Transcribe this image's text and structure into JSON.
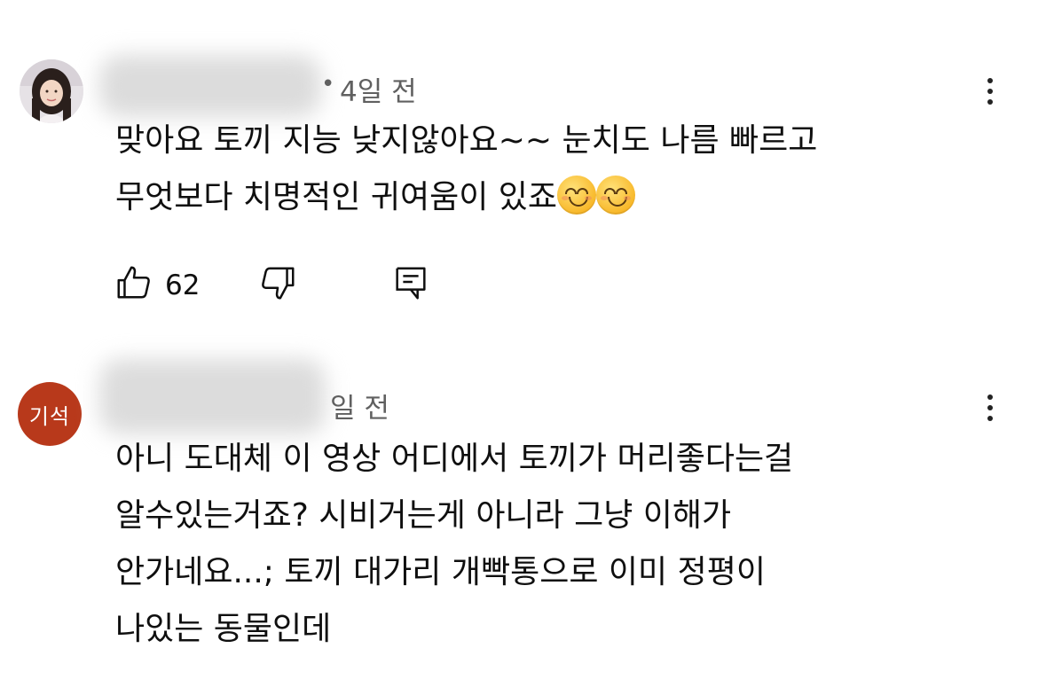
{
  "comments": [
    {
      "time": "4일 전",
      "separator": "•",
      "text_lines": [
        "맞아요 토끼 지능 낮지않아요~~ 눈치도 나름  빠르고",
        "무엇보다 치명적인 귀여움이 있죠"
      ],
      "emoji": [
        "smiling-face-emoji",
        "smiling-face-emoji"
      ],
      "likes": "62",
      "actions": [
        "like-icon",
        "dislike-icon",
        "reply-icon"
      ]
    },
    {
      "avatar_text": "기석",
      "avatar_color": "#b8391b",
      "time": "일 전",
      "text": "아니 도대체 이 영상 어디에서 토끼가 머리좋다는걸\n알수있는거죠? 시비거는게 아니라 그냥 이해가\n안가네요...; 토끼 대가리 개빡통으로 이미 정평이\n나있는 동물인데"
    }
  ]
}
